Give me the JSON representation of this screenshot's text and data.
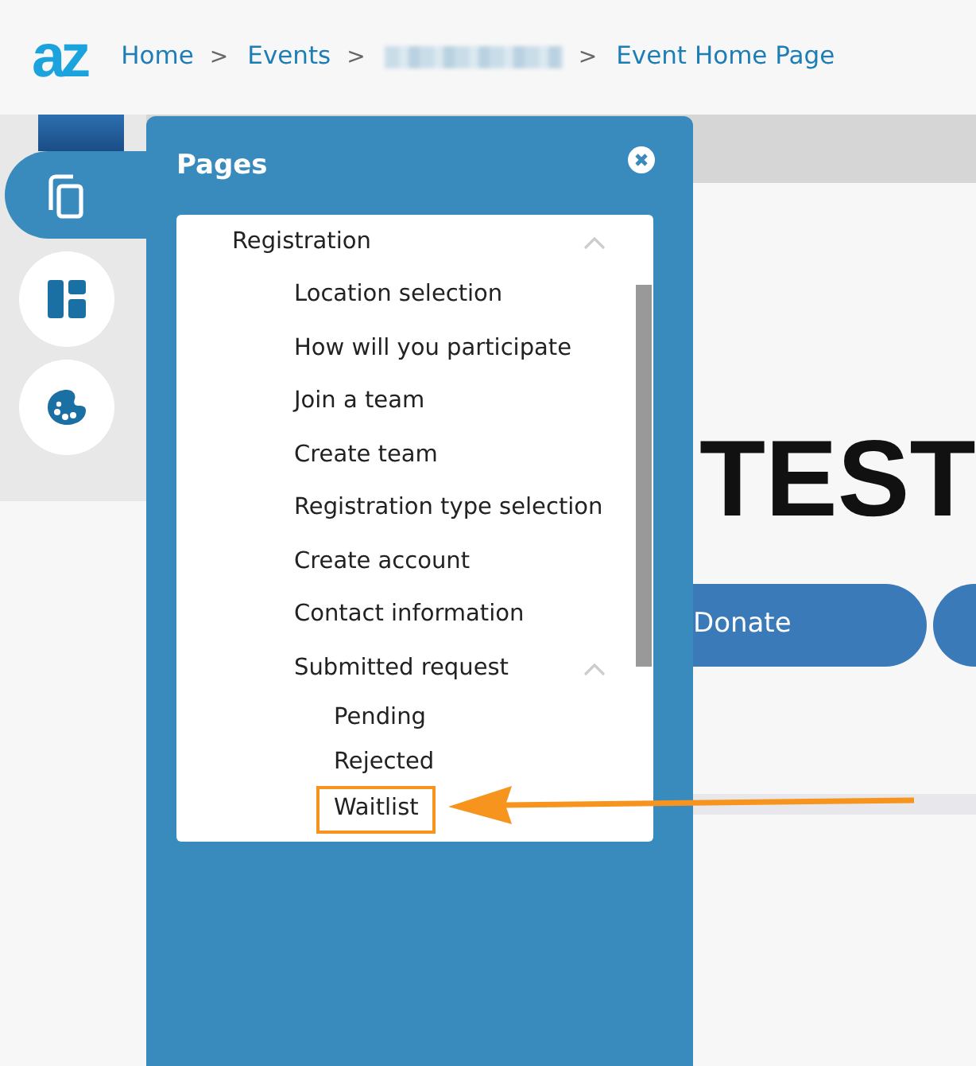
{
  "header": {
    "logo": "az",
    "breadcrumb": [
      {
        "kind": "link",
        "label": "Home"
      },
      {
        "kind": "link",
        "label": "Events"
      },
      {
        "kind": "redacted"
      },
      {
        "kind": "link",
        "label": "Event Home Page"
      }
    ],
    "separator": ">"
  },
  "sidebar": {
    "items": [
      {
        "kind": "pages",
        "selected": true
      },
      {
        "kind": "layout",
        "selected": false
      },
      {
        "kind": "palette",
        "selected": false
      }
    ]
  },
  "page": {
    "heading": "TEST",
    "buttons": [
      {
        "label": "Donate"
      }
    ]
  },
  "pages_panel": {
    "title": "Pages",
    "tree": [
      {
        "label": "Registration",
        "expanded": true,
        "children": [
          {
            "label": "Location selection",
            "highlighted": false
          },
          {
            "label": "How will you participate",
            "highlighted": false
          },
          {
            "label": "Join a team",
            "highlighted": false
          },
          {
            "label": "Create team",
            "highlighted": false
          },
          {
            "label": "Registration type selection",
            "highlighted": false
          },
          {
            "label": "Create account",
            "highlighted": false
          },
          {
            "label": "Contact information",
            "highlighted": false
          },
          {
            "label": "Submitted request",
            "expanded": true,
            "highlighted": false,
            "children": [
              {
                "label": "Pending",
                "highlighted": false
              },
              {
                "label": "Rejected",
                "highlighted": false
              },
              {
                "label": "Waitlist",
                "highlighted": true
              }
            ]
          }
        ]
      }
    ]
  }
}
